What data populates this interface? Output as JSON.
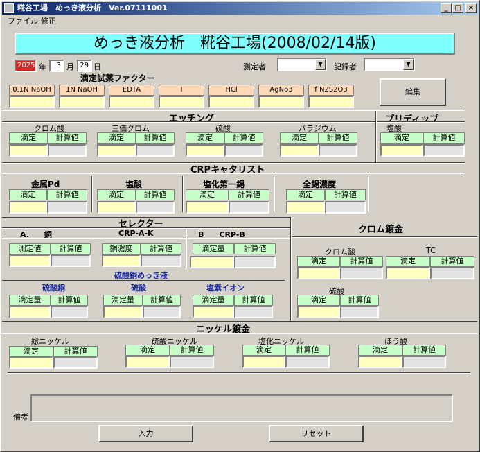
{
  "window": {
    "title": "糀谷工場　めっき液分析　Ver.07111001",
    "min_label": "_",
    "max_label": "□",
    "close_label": "×"
  },
  "menu": {
    "file": "ファイル",
    "edit": "修正"
  },
  "banner": "めっき液分析　糀谷工場(2008/02/14版)",
  "date": {
    "year_value": "2025",
    "year_label": "年",
    "month_value": "3",
    "month_label": "月",
    "day_value": "29",
    "day_label": "日"
  },
  "measurer": {
    "label": "測定者",
    "value": ""
  },
  "recorder": {
    "label": "記録者",
    "value": ""
  },
  "factor": {
    "title": "滴定試薬ファクター",
    "items": [
      "0.1N NaOH",
      "1N NaOH",
      "EDTA",
      "I",
      "HCl",
      "AgNo3",
      "f N2S2O3"
    ]
  },
  "edit_button": "編集",
  "common": {
    "titration": "滴定",
    "calc": "計算値",
    "measured": "測定値",
    "titr_amount": "滴定量",
    "cu_conc": "銅濃度"
  },
  "etching": {
    "title": "エッチング",
    "subs": [
      "クロム酸",
      "三価クロム",
      "硫酸",
      "パラジウム"
    ]
  },
  "predip": {
    "title": "プリディップ",
    "sub": "塩酸"
  },
  "crp": {
    "title": "CRPキャタリスト",
    "subs": [
      "金属Pd",
      "塩酸",
      "塩化第一錫",
      "全錫濃度"
    ]
  },
  "selector": {
    "title": "セレクター",
    "a_label": "A.　　銅",
    "crp_ak": "CRP-A-K",
    "b_label": "B　　CRP-B",
    "plating_label": "硫酸銅めっき液",
    "subs": [
      "硫酸銅",
      "硫酸",
      "塩素イオン"
    ]
  },
  "chrome": {
    "title": "クロム鍍金",
    "subs": [
      "クロム酸",
      "TC",
      "硫酸"
    ]
  },
  "nickel": {
    "title": "ニッケル鍍金",
    "subs": [
      "総ニッケル",
      "硫酸ニッケル",
      "塩化ニッケル",
      "ほう酸"
    ]
  },
  "remarks": {
    "label": "備考",
    "value": ""
  },
  "buttons": {
    "input": "入力",
    "reset": "リセット"
  }
}
